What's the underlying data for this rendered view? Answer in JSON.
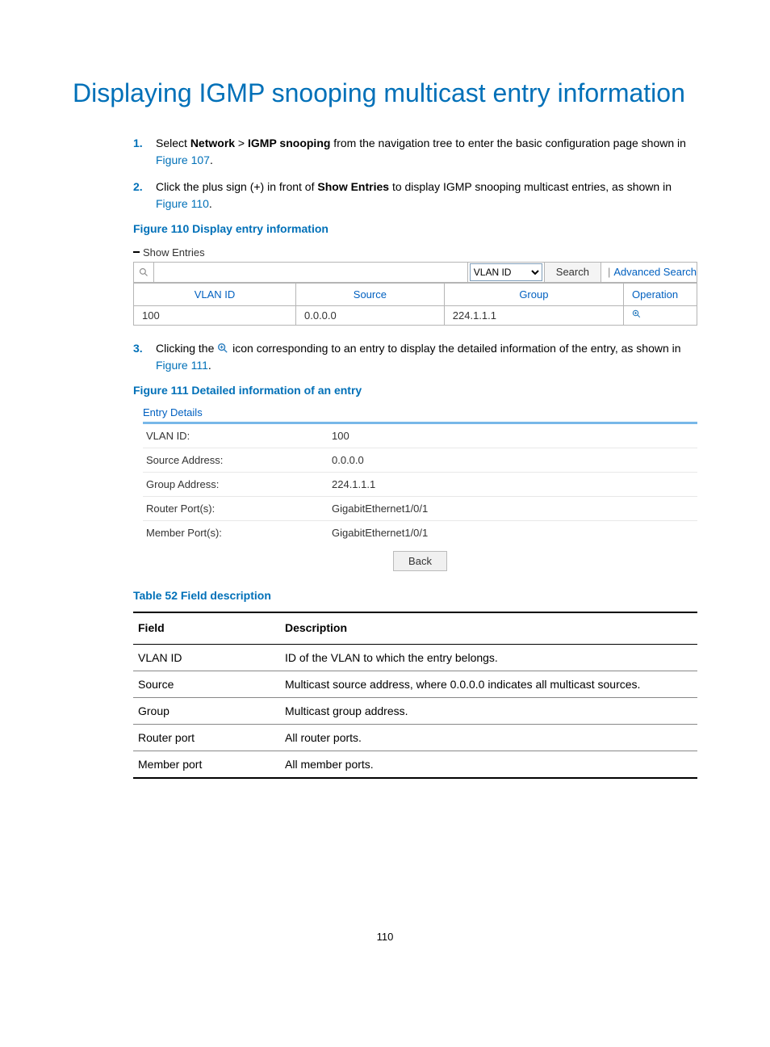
{
  "title": "Displaying IGMP snooping multicast entry information",
  "steps": {
    "s1": {
      "num": "1.",
      "pre": "Select ",
      "bold1": "Network",
      "sep": " > ",
      "bold2": "IGMP snooping",
      "post": " from the navigation tree to enter the basic configuration page shown in ",
      "link": "Figure 107",
      "tail": "."
    },
    "s2": {
      "num": "2.",
      "pre": "Click the plus sign (+) in front of ",
      "bold": "Show Entries",
      "post": " to display IGMP snooping multicast entries, as shown in ",
      "link": "Figure 110",
      "tail": "."
    },
    "s3": {
      "num": "3.",
      "pre": "Clicking the ",
      "post": " icon corresponding to an entry to display the detailed information of the entry, as shown in ",
      "link": "Figure 111",
      "tail": "."
    }
  },
  "fig110_caption": "Figure 110 Display entry information",
  "fig110": {
    "header": "Show Entries",
    "vlan_select": "VLAN ID",
    "search_btn": "Search",
    "adv_search": "Advanced Search",
    "cols": {
      "c1": "VLAN ID",
      "c2": "Source",
      "c3": "Group",
      "c4": "Operation"
    },
    "row": {
      "vlan": "100",
      "source": "0.0.0.0",
      "group": "224.1.1.1"
    }
  },
  "fig111_caption": "Figure 111 Detailed information of an entry",
  "fig111": {
    "title": "Entry Details",
    "rows": {
      "r1l": "VLAN ID:",
      "r1v": "100",
      "r2l": "Source Address:",
      "r2v": "0.0.0.0",
      "r3l": "Group Address:",
      "r3v": "224.1.1.1",
      "r4l": "Router Port(s):",
      "r4v": "GigabitEthernet1/0/1",
      "r5l": "Member Port(s):",
      "r5v": "GigabitEthernet1/0/1"
    },
    "back": "Back"
  },
  "table52_caption": "Table 52 Field description",
  "table52": {
    "h1": "Field",
    "h2": "Description",
    "rows": {
      "r1f": "VLAN ID",
      "r1d": "ID of the VLAN to which the entry belongs.",
      "r2f": "Source",
      "r2d": "Multicast source address, where 0.0.0.0 indicates all multicast sources.",
      "r3f": "Group",
      "r3d": "Multicast group address.",
      "r4f": "Router port",
      "r4d": "All router ports.",
      "r5f": "Member port",
      "r5d": "All member ports."
    }
  },
  "page_number": "110"
}
